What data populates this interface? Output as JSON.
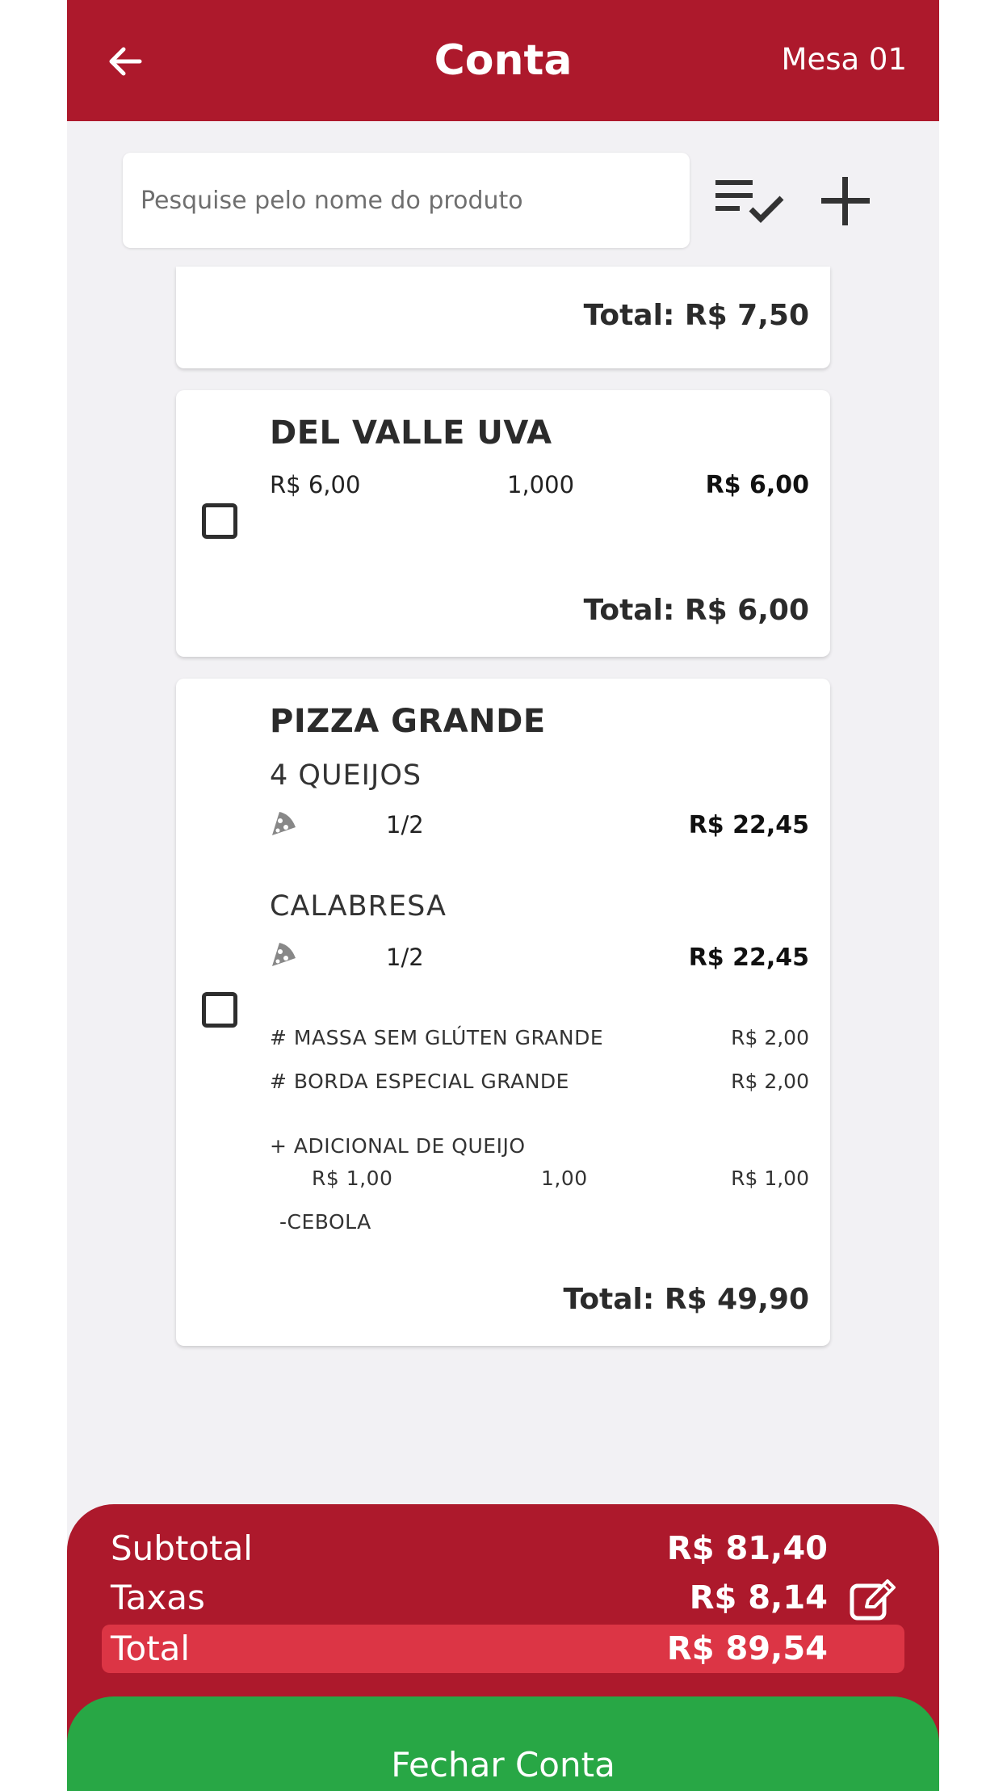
{
  "header": {
    "title": "Conta",
    "table": "Mesa 01"
  },
  "search": {
    "placeholder": "Pesquise pelo nome do produto"
  },
  "items": [
    {
      "total": "Total: R$ 7,50"
    },
    {
      "name": "DEL VALLE UVA",
      "unit_price": "R$ 6,00",
      "quantity": "1,000",
      "line_price": "R$ 6,00",
      "total": "Total: R$ 6,00"
    },
    {
      "name": "PIZZA GRANDE",
      "flavors": [
        {
          "name": "4 QUEIJOS",
          "fraction": "1/2",
          "price": "R$ 22,45"
        },
        {
          "name": "CALABRESA",
          "fraction": "1/2",
          "price": "R$ 22,45"
        }
      ],
      "options": [
        {
          "name": "# MASSA SEM GLÚTEN GRANDE",
          "price": "R$ 2,00"
        },
        {
          "name": "# BORDA ESPECIAL  GRANDE",
          "price": "R$ 2,00"
        }
      ],
      "addition": {
        "name": "+ ADICIONAL DE QUEIJO",
        "unit_price": "R$ 1,00",
        "quantity": "1,00",
        "price": "R$ 1,00"
      },
      "removal": "-CEBOLA",
      "total": "Total: R$ 49,90"
    }
  ],
  "summary": {
    "subtotal_label": "Subtotal",
    "subtotal_value": "R$ 81,40",
    "fees_label": "Taxas",
    "fees_value": "R$ 8,14",
    "total_label": "Total",
    "total_value": "R$ 89,54"
  },
  "actions": {
    "close_label": "Fechar Conta"
  },
  "colors": {
    "brand_red": "#ad192c",
    "total_red": "#dc3545",
    "close_green": "#28a745",
    "background": "#f2f1f4"
  },
  "icons": {
    "back": "arrow-left-icon",
    "checklist": "checklist-icon",
    "add": "plus-icon",
    "pizza": "pizza-slice-icon",
    "edit": "edit-icon"
  }
}
